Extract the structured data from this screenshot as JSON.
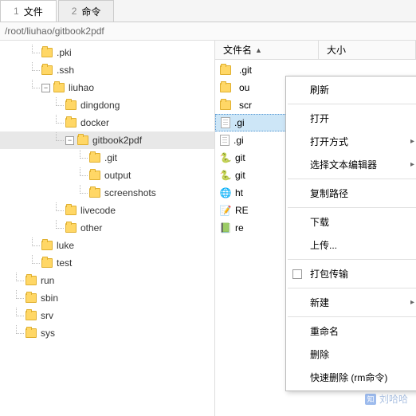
{
  "tabs": [
    {
      "num": "1",
      "label": "文件",
      "active": true
    },
    {
      "num": "2",
      "label": "命令",
      "active": false
    }
  ],
  "path": "/root/liuhao/gitbook2pdf",
  "tree": [
    {
      "indent": 40,
      "exp": "",
      "label": ".pki"
    },
    {
      "indent": 40,
      "exp": "",
      "label": ".ssh"
    },
    {
      "indent": 40,
      "exp": "−",
      "label": "liuhao"
    },
    {
      "indent": 70,
      "exp": "",
      "label": "dingdong"
    },
    {
      "indent": 70,
      "exp": "",
      "label": "docker"
    },
    {
      "indent": 70,
      "exp": "−",
      "label": "gitbook2pdf",
      "selected": true
    },
    {
      "indent": 100,
      "exp": "",
      "label": ".git"
    },
    {
      "indent": 100,
      "exp": "",
      "label": "output"
    },
    {
      "indent": 100,
      "exp": "",
      "label": "screenshots"
    },
    {
      "indent": 70,
      "exp": "",
      "label": "livecode"
    },
    {
      "indent": 70,
      "exp": "",
      "label": "other"
    },
    {
      "indent": 40,
      "exp": "",
      "label": "luke"
    },
    {
      "indent": 40,
      "exp": "",
      "label": "test"
    },
    {
      "indent": 20,
      "exp": "",
      "label": "run"
    },
    {
      "indent": 20,
      "exp": "",
      "label": "sbin"
    },
    {
      "indent": 20,
      "exp": "",
      "label": "srv"
    },
    {
      "indent": 20,
      "exp": "",
      "label": "sys"
    }
  ],
  "list": {
    "headers": {
      "name": "文件名",
      "size": "大小"
    },
    "rows": [
      {
        "icon": "folder",
        "label": ".git"
      },
      {
        "icon": "folder",
        "label": "ou"
      },
      {
        "icon": "folder",
        "label": "scr"
      },
      {
        "icon": "doc",
        "label": ".gi",
        "selected": true
      },
      {
        "icon": "doc",
        "label": ".gi"
      },
      {
        "icon": "py",
        "label": "git"
      },
      {
        "icon": "py",
        "label": "git"
      },
      {
        "icon": "html",
        "label": "ht"
      },
      {
        "icon": "md",
        "label": "RE"
      },
      {
        "icon": "txt",
        "label": "re"
      }
    ]
  },
  "menu": {
    "refresh": "刷新",
    "open": "打开",
    "open_with": "打开方式",
    "select_editor": "选择文本编辑器",
    "copy_path": "复制路径",
    "download": "下载",
    "upload": "上传...",
    "pack_transfer": "打包传输",
    "new": "新建",
    "rename": "重命名",
    "delete": "删除",
    "quick_delete": "快速删除 (rm命令)"
  },
  "watermark": "刘哈哈"
}
